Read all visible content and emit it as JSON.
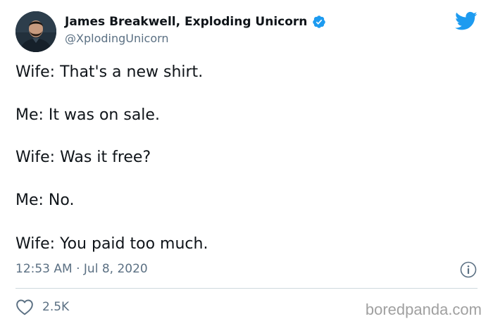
{
  "author": {
    "display_name": "James Breakwell, Exploding Unicorn",
    "handle": "@XplodingUnicorn",
    "verified": true,
    "avatar_icon": "profile-photo"
  },
  "tweet": {
    "lines": [
      "Wife: That's a new shirt.",
      "Me: It was on sale.",
      "Wife: Was it free?",
      "Me: No.",
      "Wife: You paid too much."
    ],
    "timestamp": "12:53 AM · Jul 8, 2020"
  },
  "engagement": {
    "likes": "2.5K"
  },
  "icons": {
    "brand": "twitter-bird-icon",
    "verified": "verified-badge-icon",
    "info": "info-icon",
    "like": "heart-icon"
  },
  "colors": {
    "twitter_blue": "#1d9bf0",
    "secondary_text": "#5b7083",
    "divider": "#cfd9de"
  },
  "watermark": "boredpanda.com"
}
